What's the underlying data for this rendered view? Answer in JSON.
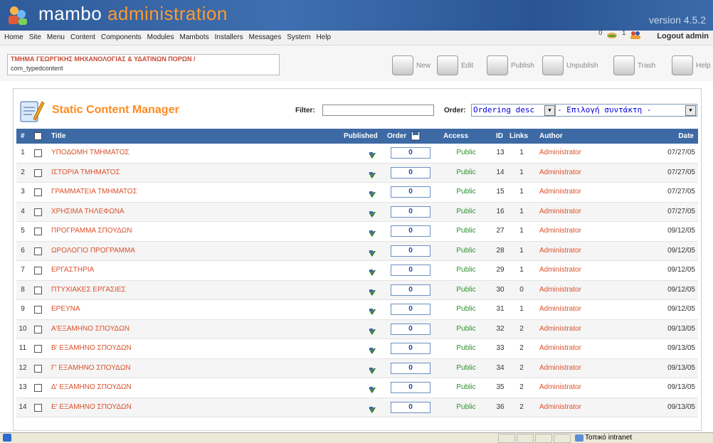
{
  "header": {
    "brand_main": "mambo",
    "brand_accent": "administration",
    "version": "version 4.5.2"
  },
  "menubar": {
    "items": [
      "Home",
      "Site",
      "Menu",
      "Content",
      "Components",
      "Modules",
      "Mambots",
      "Installers",
      "Messages",
      "System",
      "Help"
    ],
    "messages_count": "0",
    "users_count": "1",
    "logout_label": "Logout admin"
  },
  "pathway": {
    "department": "ΤΜΗΜΑ ΓΕΩΡΓΙΚΗΣ ΜΗΧΑΝΟΛΟΓΙΑΣ & ΥΔΑΤΙΝΩΝ ΠΟΡΩΝ /",
    "component": "com_typedcontent"
  },
  "toolbar": {
    "new": "New",
    "edit": "Edit",
    "publish": "Publish",
    "unpublish": "Unpublish",
    "trash": "Trash",
    "help": "Help"
  },
  "manager": {
    "title": "Static Content Manager",
    "filter_label": "Filter:",
    "filter_value": "",
    "order_label": "Order:",
    "order_selected": "Ordering desc",
    "author_selected": "- Επιλογή συντάκτη -"
  },
  "table": {
    "headers": {
      "num": "#",
      "title": "Title",
      "published": "Published",
      "order": "Order",
      "access": "Access",
      "id": "ID",
      "links": "Links",
      "author": "Author",
      "date": "Date"
    },
    "rows": [
      {
        "num": "1",
        "title": "ΥΠΟΔΟΜΗ ΤΜΗΜΑΤΟΣ",
        "order": "0",
        "access": "Public",
        "id": "13",
        "links": "1",
        "author": "Administrator",
        "date": "07/27/05"
      },
      {
        "num": "2",
        "title": "ΙΣΤΟΡΙΑ ΤΜΗΜΑΤΟΣ",
        "order": "0",
        "access": "Public",
        "id": "14",
        "links": "1",
        "author": "Administrator",
        "date": "07/27/05"
      },
      {
        "num": "3",
        "title": "ΓΡΑΜΜΑΤΕΙΑ ΤΜΗΜΑΤΟΣ",
        "order": "0",
        "access": "Public",
        "id": "15",
        "links": "1",
        "author": "Administrator",
        "date": "07/27/05"
      },
      {
        "num": "4",
        "title": "ΧΡΗΣΙΜΑ ΤΗΛΕΦΩΝΑ",
        "order": "0",
        "access": "Public",
        "id": "16",
        "links": "1",
        "author": "Administrator",
        "date": "07/27/05"
      },
      {
        "num": "5",
        "title": "ΠΡΟΓΡΑΜΜΑ ΣΠΟΥΔΩΝ",
        "order": "0",
        "access": "Public",
        "id": "27",
        "links": "1",
        "author": "Administrator",
        "date": "09/12/05"
      },
      {
        "num": "6",
        "title": "ΩΡΟΛΟΓΙΟ ΠΡΟΓΡΑΜΜΑ",
        "order": "0",
        "access": "Public",
        "id": "28",
        "links": "1",
        "author": "Administrator",
        "date": "09/12/05"
      },
      {
        "num": "7",
        "title": "ΕΡΓΑΣΤΗΡΙΑ",
        "order": "0",
        "access": "Public",
        "id": "29",
        "links": "1",
        "author": "Administrator",
        "date": "09/12/05"
      },
      {
        "num": "8",
        "title": "ΠΤΥΧΙΑΚΕΣ ΕΡΓΑΣΙΕΣ",
        "order": "0",
        "access": "Public",
        "id": "30",
        "links": "0",
        "author": "Administrator",
        "date": "09/12/05"
      },
      {
        "num": "9",
        "title": "ΕΡΕΥΝΑ",
        "order": "0",
        "access": "Public",
        "id": "31",
        "links": "1",
        "author": "Administrator",
        "date": "09/12/05"
      },
      {
        "num": "10",
        "title": "Α'ΕΞΑΜΗΝΟ ΣΠΟΥΔΩΝ",
        "order": "0",
        "access": "Public",
        "id": "32",
        "links": "2",
        "author": "Administrator",
        "date": "09/13/05"
      },
      {
        "num": "11",
        "title": "Β' ΕΞΑΜΗΝΟ ΣΠΟΥΔΩΝ",
        "order": "0",
        "access": "Public",
        "id": "33",
        "links": "2",
        "author": "Administrator",
        "date": "09/13/05"
      },
      {
        "num": "12",
        "title": "Γ' ΕΞΑΜΗΝΟ ΣΠΟΥΔΩΝ",
        "order": "0",
        "access": "Public",
        "id": "34",
        "links": "2",
        "author": "Administrator",
        "date": "09/13/05"
      },
      {
        "num": "13",
        "title": "Δ' ΕΞΑΜΗΝΟ ΣΠΟΥΔΩΝ",
        "order": "0",
        "access": "Public",
        "id": "35",
        "links": "2",
        "author": "Administrator",
        "date": "09/13/05"
      },
      {
        "num": "14",
        "title": "Ε' ΕΞΑΜΗΝΟ ΣΠΟΥΔΩΝ",
        "order": "0",
        "access": "Public",
        "id": "36",
        "links": "2",
        "author": "Administrator",
        "date": "09/13/05"
      }
    ]
  },
  "statusbar": {
    "zone": "Τοπικό intranet"
  },
  "colors": {
    "header_blue": "#3d6aa4",
    "accent_orange": "#ff8a1f",
    "link_red": "#d9512c",
    "access_green": "#28922a"
  }
}
